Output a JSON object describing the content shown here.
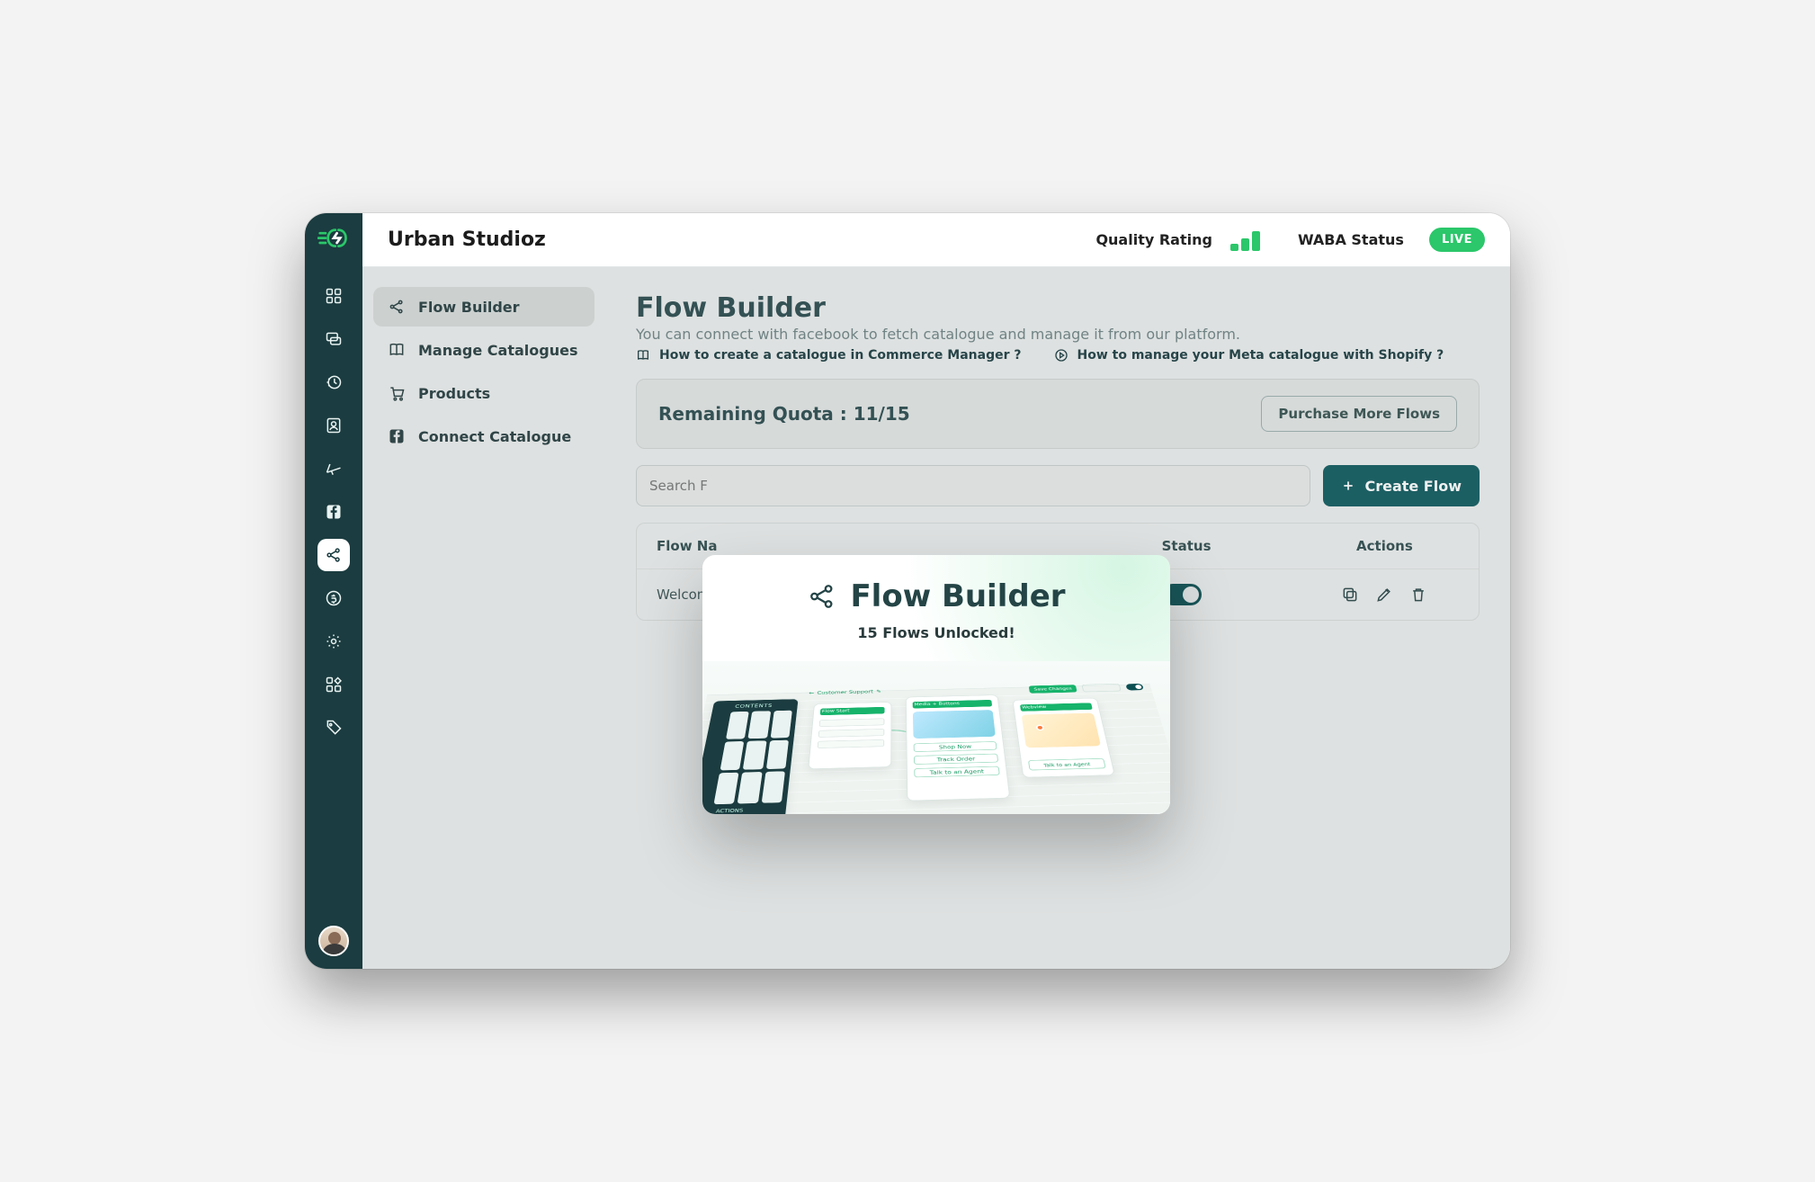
{
  "header": {
    "brand": "Urban Studioz",
    "quality_label": "Quality Rating",
    "waba_label": "WABA Status",
    "live_badge": "LIVE"
  },
  "subnav": {
    "items": [
      {
        "label": "Flow Builder"
      },
      {
        "label": "Manage Catalogues"
      },
      {
        "label": "Products"
      },
      {
        "label": "Connect Catalogue"
      }
    ]
  },
  "page": {
    "title": "Flow Builder",
    "description": "You can connect with facebook to fetch catalogue and manage it from our platform.",
    "help1": "How to create a catalogue in Commerce Manager ?",
    "help2": "How to manage your Meta catalogue with Shopify ?"
  },
  "quota": {
    "label": "Remaining Quota : 11/15",
    "button": "Purchase More Flows"
  },
  "toolbar": {
    "search_placeholder": "Search F",
    "create_label": "Create Flow"
  },
  "table": {
    "headers": {
      "name": "Flow Na",
      "cat": "",
      "upd": "",
      "status": "Status",
      "actions": "Actions"
    },
    "rows": [
      {
        "name": "Welcom"
      }
    ]
  },
  "modal": {
    "title": "Flow Builder",
    "subtitle": "15 Flows Unlocked!",
    "preview": {
      "back": "Customer Support",
      "save": "Save Changes",
      "actions_label": "ACTIONS",
      "start": "Flow Start",
      "media": "Media + Buttons",
      "webview": "Webview",
      "btn_shop": "Shop Now",
      "btn_track": "Track Order",
      "btn_agent": "Talk to an Agent",
      "web_cta": "Talk to an Agent"
    }
  }
}
